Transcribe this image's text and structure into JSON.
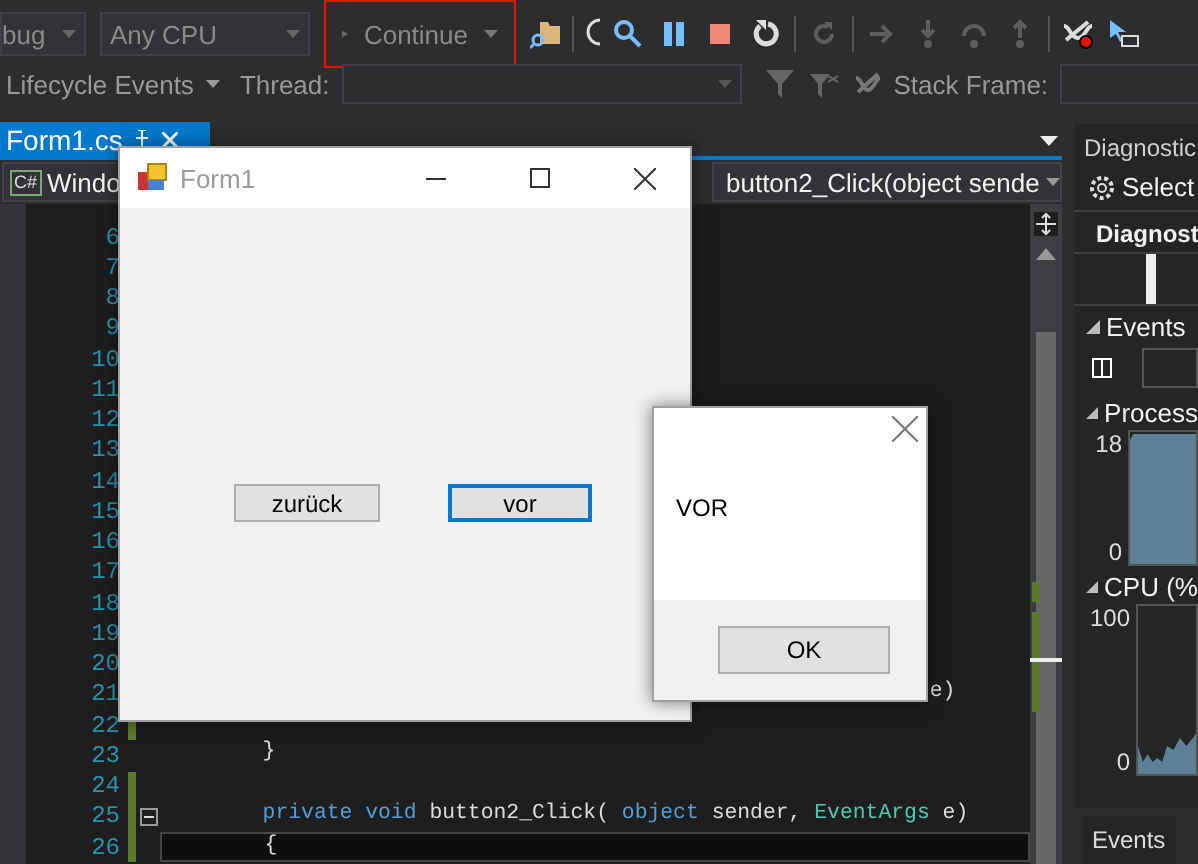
{
  "toolbar": {
    "configuration": "bug",
    "platform": "Any CPU",
    "continue": "Continue",
    "buttons": [
      {
        "kind": "find",
        "disabled": false
      },
      {
        "kind": "pause",
        "disabled": false
      },
      {
        "kind": "stop",
        "disabled": false
      },
      {
        "kind": "restart",
        "disabled": false
      },
      {
        "kind": "refresh",
        "disabled": true
      },
      {
        "kind": "show-next",
        "disabled": true
      },
      {
        "kind": "step-into",
        "disabled": true
      },
      {
        "kind": "step-over",
        "disabled": true
      },
      {
        "kind": "step-out",
        "disabled": true
      },
      {
        "kind": "breakpoints",
        "disabled": false
      },
      {
        "kind": "select",
        "disabled": false
      }
    ]
  },
  "debug_location": {
    "lifecycle": "Lifecycle Events",
    "thread_label": "Thread:",
    "stack_frame_label": "Stack Frame:"
  },
  "document_tab": {
    "title": "Form1.cs",
    "selected": true
  },
  "nav_bar": {
    "language": "C#",
    "project": "Windo",
    "member": "button2_Click(object sende"
  },
  "editor": {
    "lines": [
      {
        "number": "6"
      },
      {
        "number": "7"
      },
      {
        "number": "8"
      },
      {
        "number": "9"
      },
      {
        "number": "10"
      },
      {
        "number": "11"
      },
      {
        "number": "12"
      },
      {
        "number": "13"
      },
      {
        "number": "14"
      },
      {
        "number": "15"
      },
      {
        "number": "16"
      },
      {
        "number": "17"
      },
      {
        "number": "18"
      },
      {
        "number": "19"
      },
      {
        "number": "20"
      },
      {
        "number": "21",
        "kind": "continuation",
        "code": [
          {
            "text": "e)",
            "kind": "plain"
          }
        ]
      },
      {
        "number": "22",
        "changed": true
      },
      {
        "number": "23",
        "kind": "member",
        "code": [
          {
            "text": "}",
            "kind": "plain"
          }
        ]
      },
      {
        "number": "24",
        "changed": true
      },
      {
        "number": "25",
        "kind": "member",
        "changed": true,
        "fold": true,
        "code": [
          {
            "text": "private void",
            "kind": "keyword"
          },
          {
            "text": "button2_Click(",
            "kind": "plain"
          },
          {
            "text": "object",
            "kind": "keyword"
          },
          {
            "text": "sender,",
            "kind": "plain"
          },
          {
            "text": "EventArgs",
            "kind": "type"
          },
          {
            "text": "e)",
            "kind": "plain"
          }
        ]
      },
      {
        "number": "26",
        "kind": "member",
        "changed": true,
        "current": true,
        "code": [
          {
            "text": "{",
            "kind": "plain"
          }
        ]
      }
    ]
  },
  "diagnostics": {
    "title": "Diagnostic",
    "select": "Select",
    "heading": "Diagnost",
    "sections": [
      {
        "title": "Events",
        "kind": "events",
        "expanded": true
      },
      {
        "title": "Process",
        "kind": "memory",
        "expanded": true,
        "max": "18",
        "min": "0"
      },
      {
        "title": "CPU (%",
        "kind": "cpu",
        "expanded": true,
        "max": "100",
        "min": "0"
      }
    ],
    "tabs": [
      {
        "label": "Events",
        "selected": true
      }
    ]
  },
  "form1": {
    "title": "Form1",
    "active": false,
    "buttons": [
      {
        "label": "zurück",
        "default": false
      },
      {
        "label": "vor",
        "default": true
      }
    ]
  },
  "message_box": {
    "message": "VOR",
    "button": "OK"
  }
}
